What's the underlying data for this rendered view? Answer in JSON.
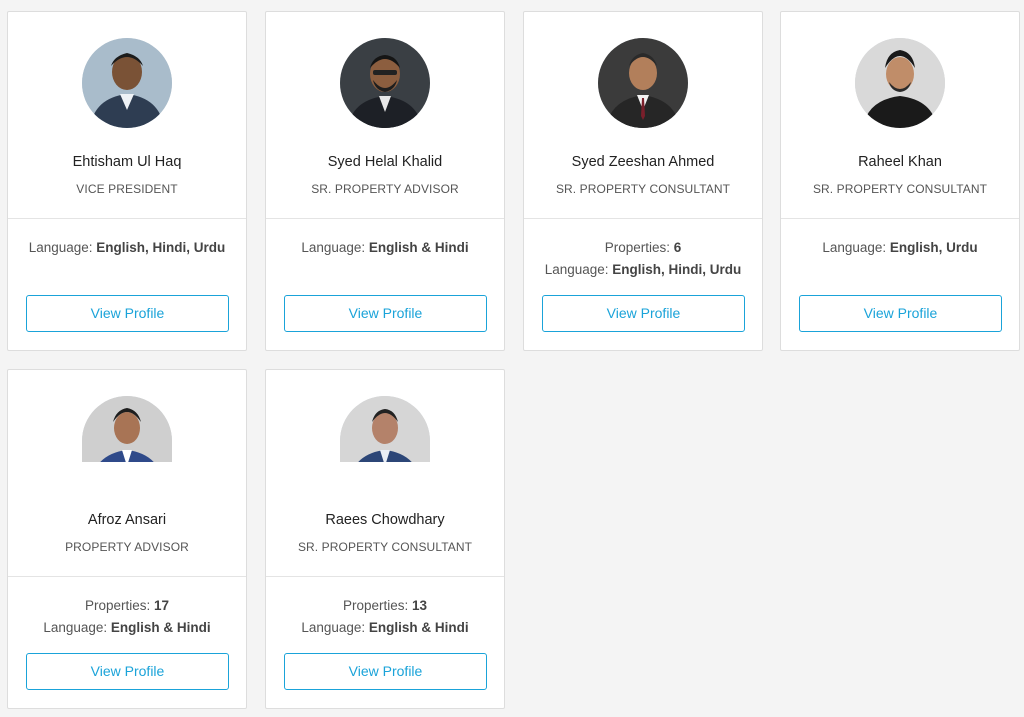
{
  "colors": {
    "accent": "#1aa3d9",
    "background": "#f4f4f4",
    "card": "#ffffff"
  },
  "agents": [
    {
      "name": "Ehtisham Ul Haq",
      "title": "VICE PRESIDENT",
      "properties_label": "",
      "properties": "",
      "language_label": "Language: ",
      "languages": "English, Hindi, Urdu",
      "button": "View Profile",
      "photo": "photo-icon"
    },
    {
      "name": "Syed Helal Khalid",
      "title": "SR. PROPERTY ADVISOR",
      "properties_label": "",
      "properties": "",
      "language_label": "Language: ",
      "languages": "English & Hindi",
      "button": "View Profile",
      "photo": "photo-icon"
    },
    {
      "name": "Syed Zeeshan Ahmed",
      "title": "SR. PROPERTY CONSULTANT",
      "properties_label": "Properties: ",
      "properties": "6",
      "language_label": "Language: ",
      "languages": "English, Hindi, Urdu",
      "button": "View Profile",
      "photo": "photo-icon"
    },
    {
      "name": "Raheel Khan",
      "title": "SR. PROPERTY CONSULTANT",
      "properties_label": "",
      "properties": "",
      "language_label": "Language: ",
      "languages": "English, Urdu",
      "button": "View Profile",
      "photo": "photo-icon"
    },
    {
      "name": "Afroz Ansari",
      "title": "PROPERTY ADVISOR",
      "properties_label": "Properties: ",
      "properties": "17",
      "language_label": "Language: ",
      "languages": "English & Hindi",
      "button": "View Profile",
      "photo": "photo-icon"
    },
    {
      "name": "Raees Chowdhary",
      "title": "SR. PROPERTY CONSULTANT",
      "properties_label": "Properties: ",
      "properties": "13",
      "language_label": "Language: ",
      "languages": "English & Hindi",
      "button": "View Profile",
      "photo": "photo-icon"
    }
  ]
}
